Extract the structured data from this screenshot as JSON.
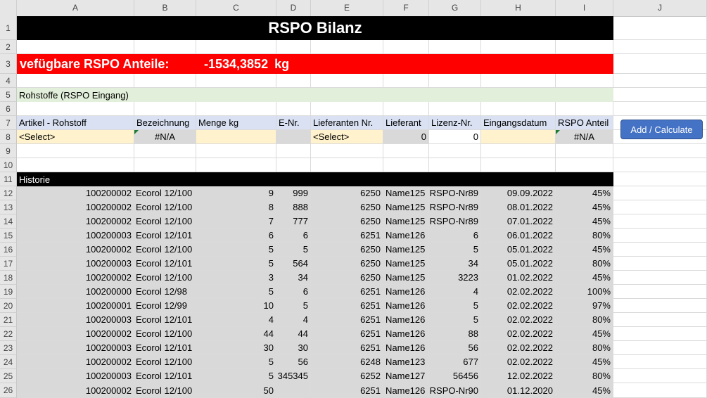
{
  "columns": [
    "A",
    "B",
    "C",
    "D",
    "E",
    "F",
    "G",
    "H",
    "I",
    "J"
  ],
  "rows": [
    "1",
    "2",
    "3",
    "4",
    "5",
    "6",
    "7",
    "8",
    "9",
    "10",
    "11",
    "12",
    "13",
    "14",
    "15",
    "16",
    "17",
    "18",
    "19",
    "20",
    "21",
    "22",
    "23",
    "24",
    "25",
    "26"
  ],
  "title": "RSPO Bilanz",
  "available": {
    "label": "vefügbare RSPO Anteile:",
    "value": "-1534,3852",
    "unit": "kg"
  },
  "section_input": "Rohstoffe (RSPO Eingang)",
  "headers": [
    "Artikel - Rohstoff",
    "Bezeichnung",
    "Menge kg",
    "E-Nr.",
    "Lieferanten Nr.",
    "Lieferant",
    "Lizenz-Nr.",
    "Eingangsdatum",
    "RSPO Anteil"
  ],
  "input_row": [
    "<Select>",
    "#N/A",
    "",
    "",
    "<Select>",
    "0",
    "0",
    "",
    "#N/A"
  ],
  "button_label": "Add / Calculate",
  "history_label": "Historie",
  "history": [
    [
      "100200002",
      "Ecorol 12/100",
      "9",
      "999",
      "6250",
      "Name125",
      "RSPO-Nr89",
      "09.09.2022",
      "45%"
    ],
    [
      "100200002",
      "Ecorol 12/100",
      "8",
      "888",
      "6250",
      "Name125",
      "RSPO-Nr89",
      "08.01.2022",
      "45%"
    ],
    [
      "100200002",
      "Ecorol 12/100",
      "7",
      "777",
      "6250",
      "Name125",
      "RSPO-Nr89",
      "07.01.2022",
      "45%"
    ],
    [
      "100200003",
      "Ecorol 12/101",
      "6",
      "6",
      "6251",
      "Name126",
      "6",
      "06.01.2022",
      "80%"
    ],
    [
      "100200002",
      "Ecorol 12/100",
      "5",
      "5",
      "6250",
      "Name125",
      "5",
      "05.01.2022",
      "45%"
    ],
    [
      "100200003",
      "Ecorol 12/101",
      "5",
      "564",
      "6250",
      "Name125",
      "34",
      "05.01.2022",
      "80%"
    ],
    [
      "100200002",
      "Ecorol 12/100",
      "3",
      "34",
      "6250",
      "Name125",
      "3223",
      "01.02.2022",
      "45%"
    ],
    [
      "100200000",
      "Ecorol 12/98",
      "5",
      "6",
      "6251",
      "Name126",
      "4",
      "02.02.2022",
      "100%"
    ],
    [
      "100200001",
      "Ecorol 12/99",
      "10",
      "5",
      "6251",
      "Name126",
      "5",
      "02.02.2022",
      "97%"
    ],
    [
      "100200003",
      "Ecorol 12/101",
      "4",
      "4",
      "6251",
      "Name126",
      "5",
      "02.02.2022",
      "80%"
    ],
    [
      "100200002",
      "Ecorol 12/100",
      "44",
      "44",
      "6251",
      "Name126",
      "88",
      "02.02.2022",
      "45%"
    ],
    [
      "100200003",
      "Ecorol 12/101",
      "30",
      "30",
      "6251",
      "Name126",
      "56",
      "02.02.2022",
      "80%"
    ],
    [
      "100200002",
      "Ecorol 12/100",
      "5",
      "56",
      "6248",
      "Name123",
      "677",
      "02.02.2022",
      "45%"
    ],
    [
      "100200003",
      "Ecorol 12/101",
      "5",
      "345345",
      "6252",
      "Name127",
      "56456",
      "12.02.2022",
      "80%"
    ],
    [
      "100200002",
      "Ecorol 12/100",
      "50",
      "",
      "6251",
      "Name126",
      "RSPO-Nr90",
      "01.12.2020",
      "45%"
    ]
  ]
}
